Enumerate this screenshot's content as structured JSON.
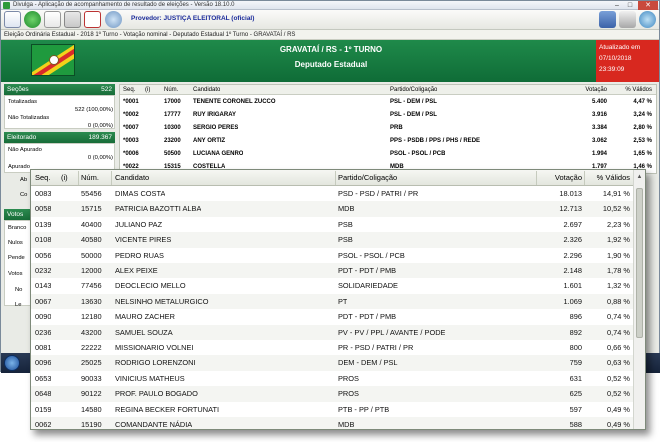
{
  "window": {
    "title": "Divulga - Aplicação de acompanhamento de resultado de eleições - Versão 18.10.0",
    "min_icon": "minimize-icon",
    "max_icon": "maximize-icon",
    "close_icon": "close-icon"
  },
  "toolbar": {
    "provedor_label": "Provedor:",
    "provedor_value": "JUSTIÇA ELEITORAL (oficial)",
    "icons": [
      "checklist-icon",
      "refresh-icon",
      "printer-icon",
      "print-preview-icon",
      "pdf-icon",
      "search-icon",
      "exit-icon",
      "tools-icon",
      "help-icon"
    ]
  },
  "infobar": {
    "text": "Eleição Ordinária Estadual - 2018 1º Turno - Votação nominal - Deputado Estadual 1º Turno - GRAVATAÍ / RS"
  },
  "header": {
    "location": "GRAVATAÍ / RS - 1º TURNO",
    "office": "Deputado Estadual",
    "updated_label": "Atualizado em",
    "updated_date": "07/10/2018",
    "updated_time": "23:39:09",
    "flag_icon": "rs-flag-icon"
  },
  "left_panel": {
    "secoes_label": "Seções",
    "secoes_value": "522",
    "totalizadas_label": "Totalizadas",
    "totalizadas_value": "522 (100,00%)",
    "nao_totalizadas_label": "Não Totalizadas",
    "nao_totalizadas_value": "0 (0,00%)",
    "eleitorado_label": "Eleitorado",
    "eleitorado_value": "189.367",
    "nao_apurado_label": "Não Apurado",
    "apurado_label": "Apurado",
    "apurado_value": "0 (0,00%)",
    "ab_label": "Ab",
    "co_label": "Co",
    "votos_label": "Votos",
    "brancos_label": "Branco",
    "nulos_label": "Nulos",
    "pendentes_label": "Pende",
    "votos2_label": "Votos",
    "no_label": "No",
    "le_label": "Le"
  },
  "back_table": {
    "headers": [
      "Seq.",
      "(i)",
      "Núm.",
      "Candidato",
      "Partido/Coligação",
      "Votação",
      "% Válidos"
    ],
    "rows": [
      {
        "seq": "*0001",
        "num": "17000",
        "cand": "TENENTE CORONEL ZUCCO",
        "party": "PSL - DEM / PSL",
        "votes": "5.400",
        "pct": "4,47 %"
      },
      {
        "seq": "*0002",
        "num": "17777",
        "cand": "RUY IRIGARAY",
        "party": "PSL - DEM / PSL",
        "votes": "3.916",
        "pct": "3,24 %"
      },
      {
        "seq": "*0007",
        "num": "10300",
        "cand": "SERGIO PERES",
        "party": "PRB",
        "votes": "3.384",
        "pct": "2,80 %"
      },
      {
        "seq": "*0003",
        "num": "23200",
        "cand": "ANY ORTIZ",
        "party": "PPS - PSDB / PPS / PHS / REDE",
        "votes": "3.062",
        "pct": "2,53 %"
      },
      {
        "seq": "*0006",
        "num": "50500",
        "cand": "LUCIANA GENRO",
        "party": "PSOL - PSOL / PCB",
        "votes": "1.994",
        "pct": "1,65 %"
      },
      {
        "seq": "*0022",
        "num": "15315",
        "cand": "COSTELLA",
        "party": "MDB",
        "votes": "1.797",
        "pct": "1,46 %"
      }
    ]
  },
  "popup": {
    "headers": [
      "Seq.",
      "(i)",
      "Núm.",
      "Candidato",
      "Partido/Coligação",
      "Votação",
      "% Válidos"
    ],
    "rows": [
      {
        "seq": "0083",
        "num": "55456",
        "cand": "DIMAS COSTA",
        "party": "PSD - PSD / PATRI / PR",
        "votes": "18.013",
        "pct": "14,91 %"
      },
      {
        "seq": "0058",
        "num": "15715",
        "cand": "PATRICIA BAZOTTI ALBA",
        "party": "MDB",
        "votes": "12.713",
        "pct": "10,52 %"
      },
      {
        "seq": "0139",
        "num": "40400",
        "cand": "JULIANO PAZ",
        "party": "PSB",
        "votes": "2.697",
        "pct": "2,23 %"
      },
      {
        "seq": "0108",
        "num": "40580",
        "cand": "VICENTE PIRES",
        "party": "PSB",
        "votes": "2.326",
        "pct": "1,92 %"
      },
      {
        "seq": "0056",
        "num": "50000",
        "cand": "PEDRO RUAS",
        "party": "PSOL - PSOL / PCB",
        "votes": "2.296",
        "pct": "1,90 %"
      },
      {
        "seq": "0232",
        "num": "12000",
        "cand": "ALEX PEIXE",
        "party": "PDT - PDT / PMB",
        "votes": "2.148",
        "pct": "1,78 %"
      },
      {
        "seq": "0143",
        "num": "77456",
        "cand": "DEOCLECIO MELLO",
        "party": "SOLIDARIEDADE",
        "votes": "1.601",
        "pct": "1,32 %"
      },
      {
        "seq": "0067",
        "num": "13630",
        "cand": "NELSINHO METALURGICO",
        "party": "PT",
        "votes": "1.069",
        "pct": "0,88 %"
      },
      {
        "seq": "0090",
        "num": "12180",
        "cand": "MAURO ZACHER",
        "party": "PDT - PDT / PMB",
        "votes": "896",
        "pct": "0,74 %"
      },
      {
        "seq": "0236",
        "num": "43200",
        "cand": "SAMUEL SOUZA",
        "party": "PV - PV / PPL / AVANTE / PODE",
        "votes": "892",
        "pct": "0,74 %"
      },
      {
        "seq": "0081",
        "num": "22222",
        "cand": "MISSIONARIO VOLNEI",
        "party": "PR - PSD / PATRI / PR",
        "votes": "800",
        "pct": "0,66 %"
      },
      {
        "seq": "0096",
        "num": "25025",
        "cand": "RODRIGO LORENZONI",
        "party": "DEM - DEM / PSL",
        "votes": "759",
        "pct": "0,63 %"
      },
      {
        "seq": "0653",
        "num": "90033",
        "cand": "VINICIUS MATHEUS",
        "party": "PROS",
        "votes": "631",
        "pct": "0,52 %"
      },
      {
        "seq": "0648",
        "num": "90122",
        "cand": "PROF. PAULO BOGADO",
        "party": "PROS",
        "votes": "625",
        "pct": "0,52 %"
      },
      {
        "seq": "0159",
        "num": "14580",
        "cand": "REGINA BECKER FORTUNATI",
        "party": "PTB - PP / PTB",
        "votes": "597",
        "pct": "0,49 %"
      },
      {
        "seq": "0062",
        "num": "15190",
        "cand": "COMANDANTE NÁDIA",
        "party": "MDB",
        "votes": "588",
        "pct": "0,49 %"
      }
    ]
  },
  "colors": {
    "header_green": "#178045",
    "update_red": "#d8281f",
    "provider_blue": "#1a2a9a"
  }
}
